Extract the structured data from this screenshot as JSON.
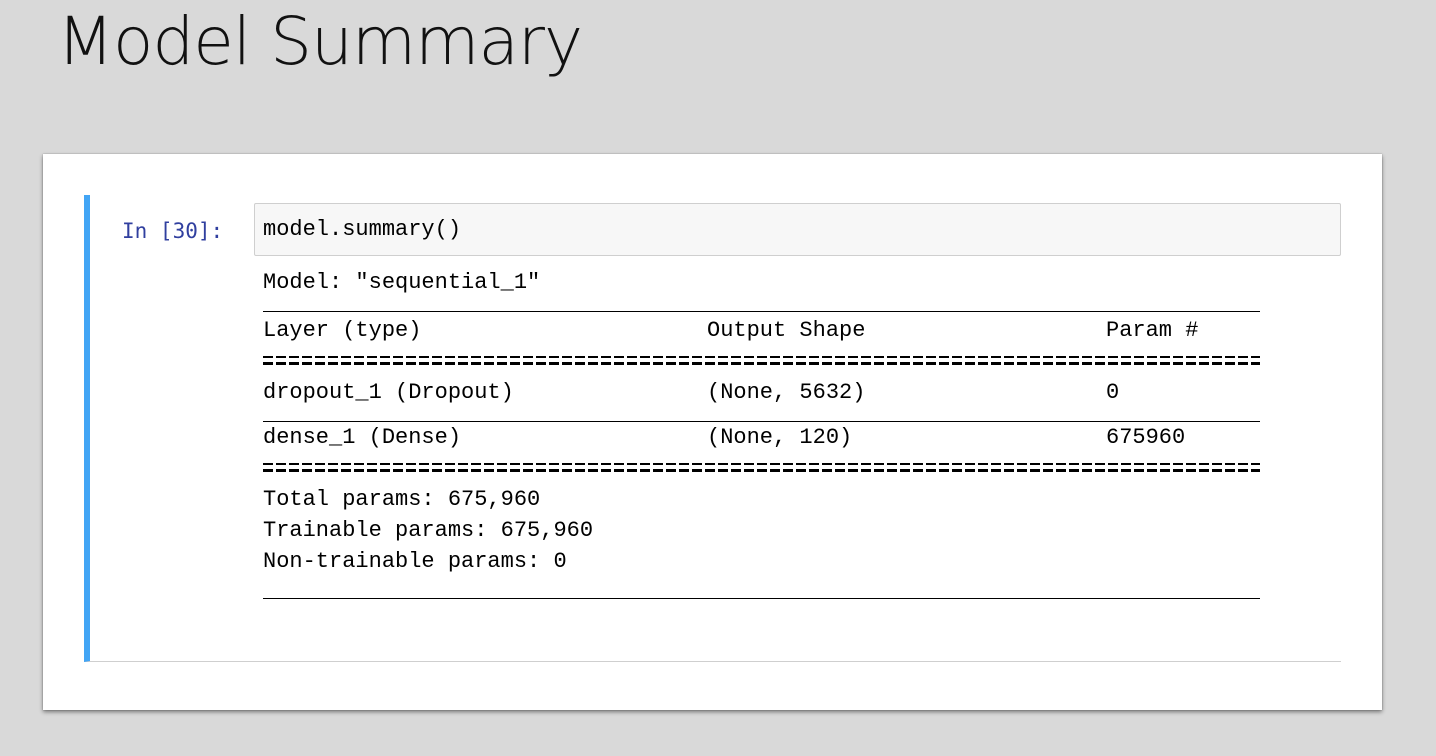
{
  "title": "Model Summary",
  "cell": {
    "prompt": "In [30]:",
    "code": "model.summary()"
  },
  "output": {
    "model_line": "Model: \"sequential_1\"",
    "headers": {
      "layer": "Layer (type)",
      "shape": "Output Shape",
      "params": "Param #"
    },
    "rows": [
      {
        "layer": "dropout_1 (Dropout)",
        "shape": "(None, 5632)",
        "params": "0"
      },
      {
        "layer": "dense_1 (Dense)",
        "shape": "(None, 120)",
        "params": "675960"
      }
    ],
    "totals": [
      "Total params: 675,960",
      "Trainable params: 675,960",
      "Non-trainable params: 0"
    ]
  },
  "colors": {
    "cell_border_accent": "#42a5f5",
    "prompt_text": "#303f9f",
    "slide_background": "#d9d9d9",
    "input_background": "#f7f7f7"
  }
}
